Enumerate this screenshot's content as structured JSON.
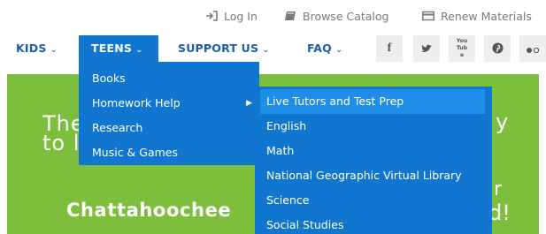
{
  "utility": {
    "login": "Log In",
    "browse": "Browse Catalog",
    "renew": "Renew Materials"
  },
  "nav": {
    "kids": "KIDS",
    "teens": "TEENS",
    "support": "SUPPORT US",
    "faq": "FAQ"
  },
  "social": {
    "facebook": "f",
    "youtube": "You Tube"
  },
  "teens_menu": [
    {
      "label": "Books"
    },
    {
      "label": "Homework Help"
    },
    {
      "label": "Research"
    },
    {
      "label": "Music & Games"
    }
  ],
  "homework_submenu": [
    {
      "label": "Live Tutors and Test Prep"
    },
    {
      "label": "English"
    },
    {
      "label": "Math"
    },
    {
      "label": "National Geographic Virtual Library"
    },
    {
      "label": "Science"
    },
    {
      "label": "Social Studies"
    }
  ],
  "hero": {
    "line1_start": "The",
    "line2_start": "to l",
    "line1_end": "y",
    "line3_end": "r",
    "line4_end": "d!",
    "brand": "Chattahoochee"
  },
  "colors": {
    "nav_text": "#1c5fa8",
    "dropdown_bg": "#1176cf",
    "dropdown_highlight": "#1e8ee8",
    "hero_bg": "#7dbf3c"
  }
}
